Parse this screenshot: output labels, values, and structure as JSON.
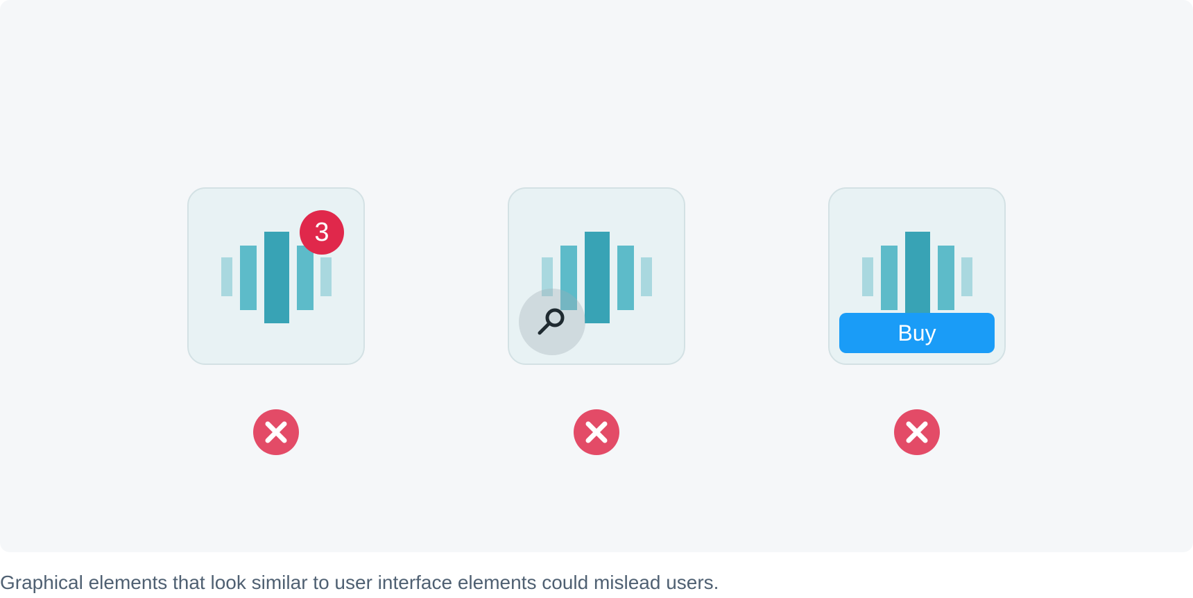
{
  "examples": [
    {
      "id": "badge-example",
      "badge_count": "3"
    },
    {
      "id": "search-example",
      "icon": "search-icon"
    },
    {
      "id": "buy-example",
      "button_label": "Buy"
    }
  ],
  "status": {
    "icon": "close-icon",
    "color": "#e34b67"
  },
  "caption": "Graphical elements that look similar to user interface elements could mislead users.",
  "colors": {
    "panel": "#f5f7f9",
    "tile": "#e8f2f4",
    "bar_light": "#a9d8df",
    "bar_mid": "#5dbbc9",
    "bar_dark": "#38a3b5",
    "badge": "#e0284b",
    "buy": "#1a9cf7"
  }
}
